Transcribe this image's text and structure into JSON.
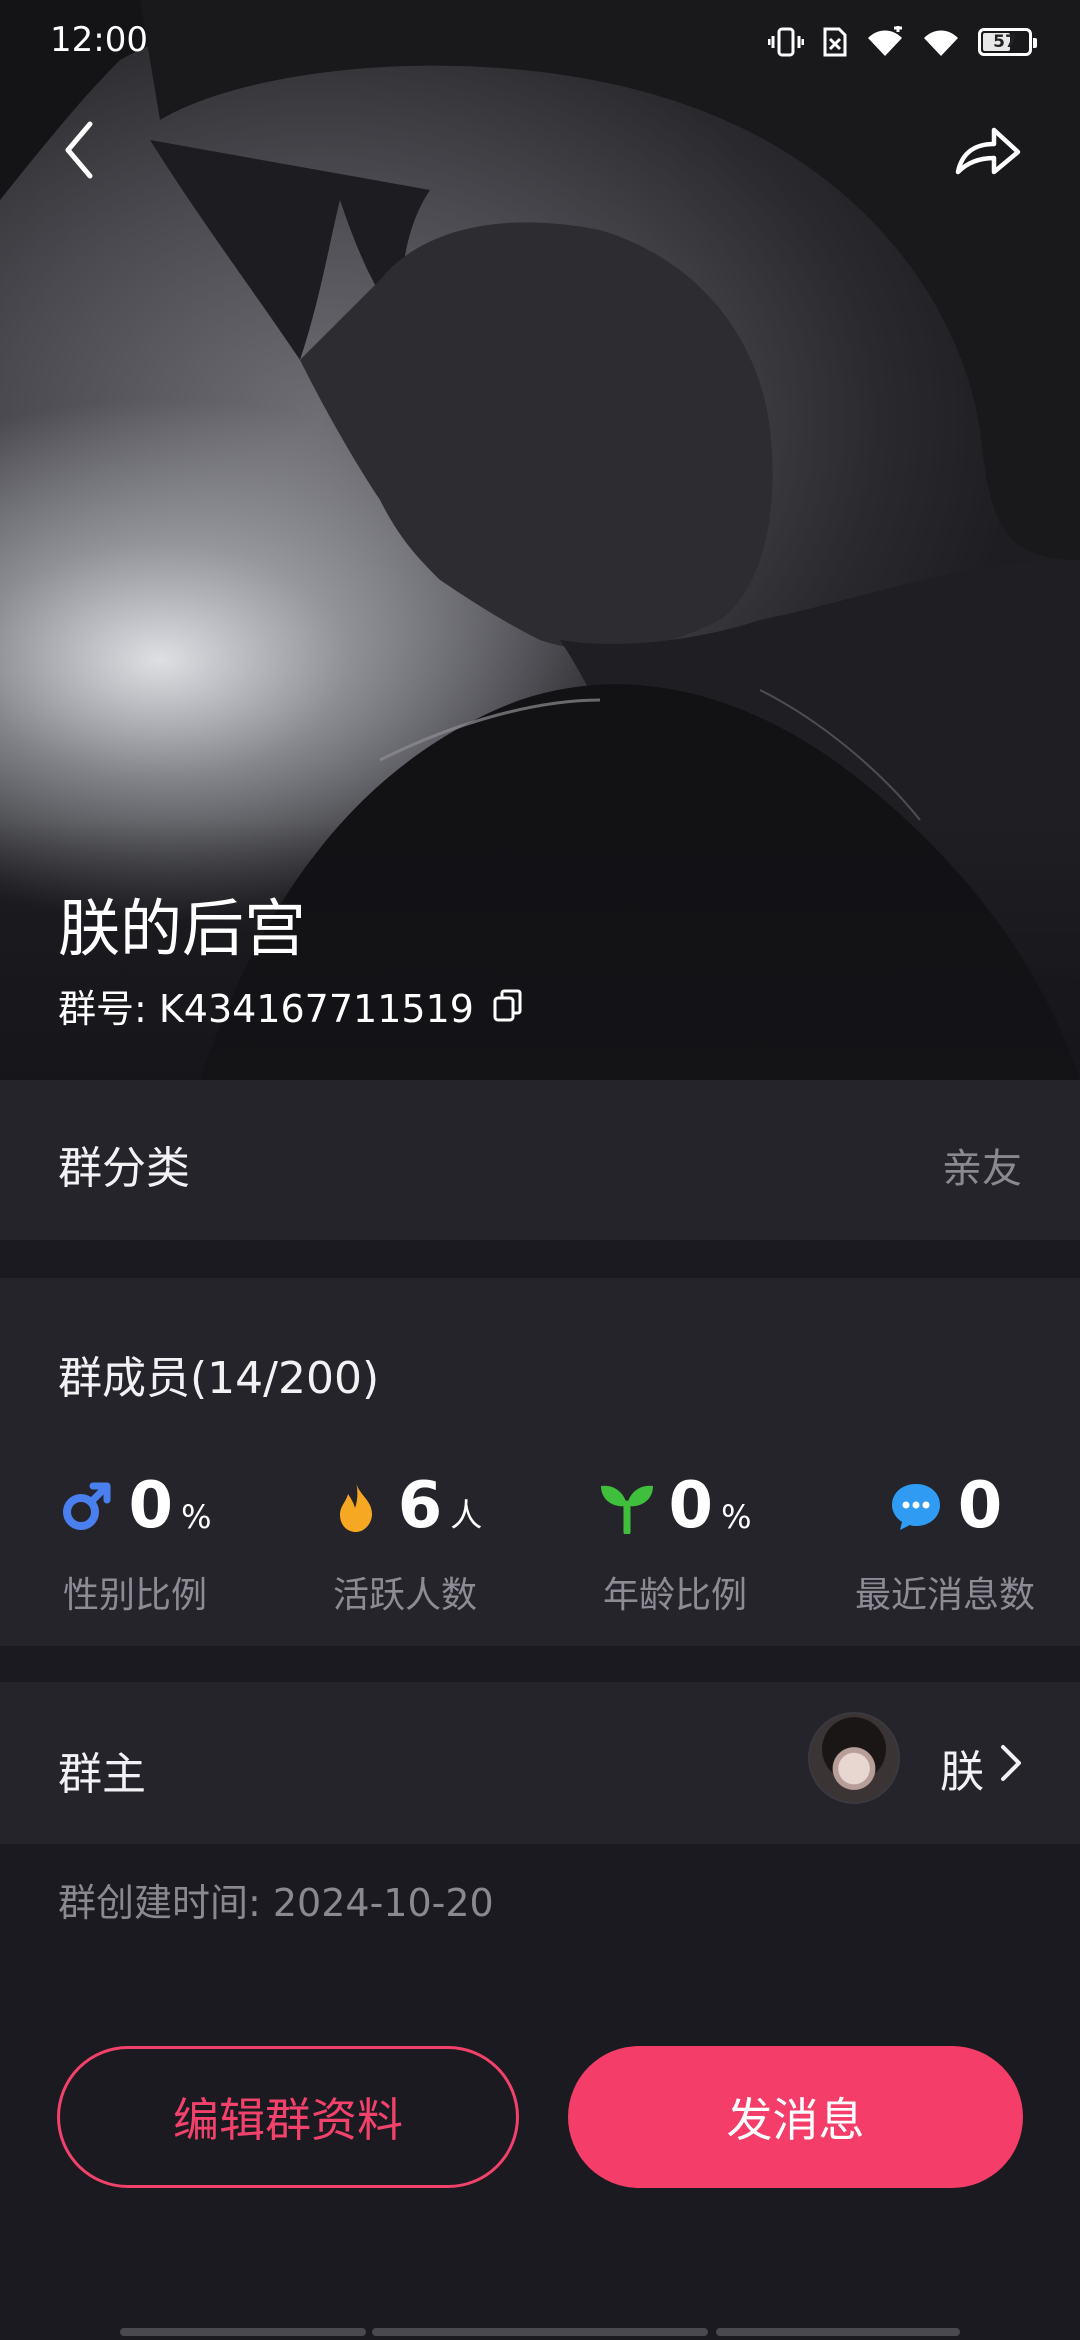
{
  "status_bar": {
    "time": "12:00",
    "battery": "57"
  },
  "header": {
    "back_icon": "chevron-left-icon",
    "share_icon": "share-arrow-icon",
    "group_name": "朕的后宫",
    "group_id": "群号: K434167711519",
    "copy_icon": "copy-icon"
  },
  "category": {
    "label": "群分类",
    "value": "亲友"
  },
  "members": {
    "title": "群成员(14/200)",
    "stats": [
      {
        "icon": "male-gender-icon",
        "value": "0",
        "unit": "%",
        "label": "性别比例",
        "color": "#4a7ff0"
      },
      {
        "icon": "flame-icon",
        "value": "6",
        "unit": "人",
        "label": "活跃人数",
        "color": "#f7a823"
      },
      {
        "icon": "sprout-icon",
        "value": "0",
        "unit": "%",
        "label": "年龄比例",
        "color": "#3fbf3b"
      },
      {
        "icon": "chat-bubble-icon",
        "value": "0",
        "unit": "",
        "label": "最近消息数",
        "color": "#2f9bf2"
      }
    ]
  },
  "owner": {
    "label": "群主",
    "name": "朕"
  },
  "created": "群创建时间: 2024-10-20",
  "actions": {
    "edit_label": "编辑群资料",
    "send_label": "发消息"
  },
  "colors": {
    "accent": "#f43d68",
    "card_bg": "#25242b",
    "page_bg": "#1b1a20"
  }
}
